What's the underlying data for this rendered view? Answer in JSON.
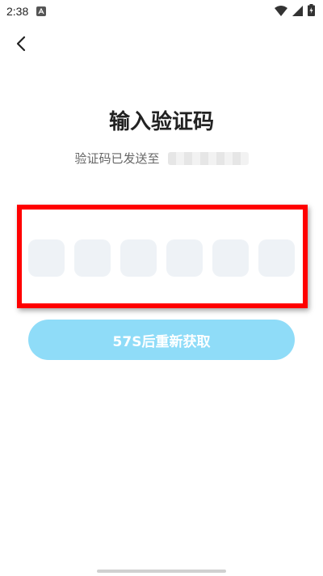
{
  "status_bar": {
    "time": "2:38",
    "icons": [
      "notification-a-icon",
      "wifi-icon",
      "signal-icon",
      "battery-icon"
    ]
  },
  "nav": {
    "back_icon": "chevron-left-icon"
  },
  "header": {
    "title": "输入验证码",
    "subtitle": "验证码已发送至"
  },
  "code_input": {
    "length": 6,
    "values": [
      "",
      "",
      "",
      "",
      "",
      ""
    ]
  },
  "resend": {
    "label": "57S后重新获取"
  },
  "colors": {
    "accent": "#8fdcf8",
    "code_box_bg": "#eef2f6",
    "highlight": "#ff0000",
    "title_text": "#222222",
    "subtitle_text": "#666666"
  }
}
